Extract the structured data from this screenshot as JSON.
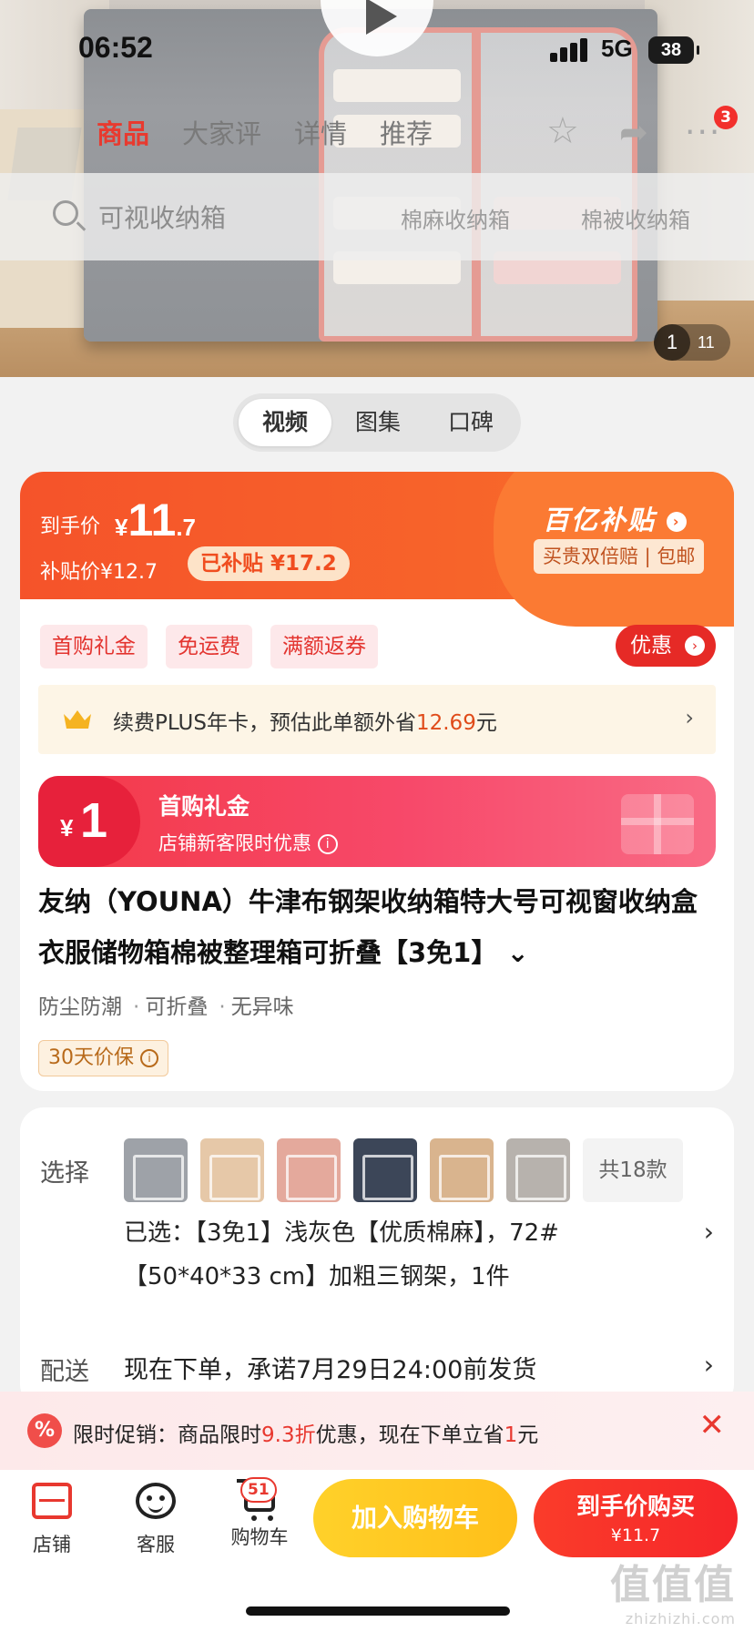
{
  "status_bar": {
    "time": "06:52",
    "network": "5G",
    "battery": "38"
  },
  "nav": {
    "tabs": [
      {
        "label": "商品",
        "active": true
      },
      {
        "label": "大家评",
        "active": false
      },
      {
        "label": "详情",
        "active": false
      },
      {
        "label": "推荐",
        "active": false
      }
    ],
    "cart_badge": "3"
  },
  "search": {
    "placeholder": "可视收纳箱",
    "hot_words": [
      "棉麻收纳箱",
      "棉被收纳箱"
    ]
  },
  "gallery": {
    "current": "1",
    "total": "11"
  },
  "media_switch": {
    "tabs": [
      {
        "label": "视频",
        "active": true
      },
      {
        "label": "图集",
        "active": false
      },
      {
        "label": "口碑",
        "active": false
      }
    ]
  },
  "price": {
    "final_label": "到手价",
    "currency": "¥",
    "final_int": "11",
    "final_dec": ".7",
    "subsidy_price_text": "补贴价¥12.7",
    "subsidy_tag": "已补贴 ¥17.2",
    "program_name": "百亿补贴",
    "program_tag": "买贵双倍赔 | 包邮"
  },
  "promo_tags": [
    "首购礼金",
    "免运费",
    "满额返券"
  ],
  "coupon_button": "优惠",
  "plus": {
    "text_prefix": "续费PLUS年卡，预估此单额外省",
    "amount": "12.69",
    "text_suffix": "元"
  },
  "gift": {
    "currency": "¥",
    "amount": "1",
    "title": "首购礼金",
    "subtitle": "店铺新客限时优惠"
  },
  "product": {
    "title": "友纳（YOUNA）牛津布钢架收纳箱特大号可视窗收纳盒衣服储物箱棉被整理箱可折叠【3免1】",
    "features": [
      "防尘防潮",
      "可折叠",
      "无异味"
    ],
    "price_guard": "30天价保"
  },
  "sku": {
    "label": "选择",
    "thumb_colors": [
      "#9ea2a8",
      "#e6c8a8",
      "#e4a99c",
      "#3c4658",
      "#d9b48e",
      "#b7b2ad"
    ],
    "more": "共18款",
    "selected": "已选：【3免1】浅灰色【优质棉麻】，72#【50*40*33 cm】加粗三钢架，1件",
    "delivery_label": "配送",
    "delivery_text": "现在下单，承诺7月29日24:00前发货"
  },
  "flash_sale": {
    "prefix": "限时促销：商品限时",
    "discount": "9.3折",
    "middle": "优惠，现在下单立省",
    "saving": "1",
    "suffix": "元"
  },
  "bottom_bar": {
    "shop": "店铺",
    "service": "客服",
    "cart": "购物车",
    "cart_count": "51",
    "add_cart": "加入购物车",
    "buy_line1": "到手价购买",
    "buy_line2": "¥11.7"
  },
  "watermark": {
    "line1": "值值值",
    "line2": "zhizhizhi.com"
  },
  "colors": {
    "accent": "#e8382f",
    "banner_orange": "#f7632a",
    "add_cart_yellow": "#ffc61f"
  }
}
